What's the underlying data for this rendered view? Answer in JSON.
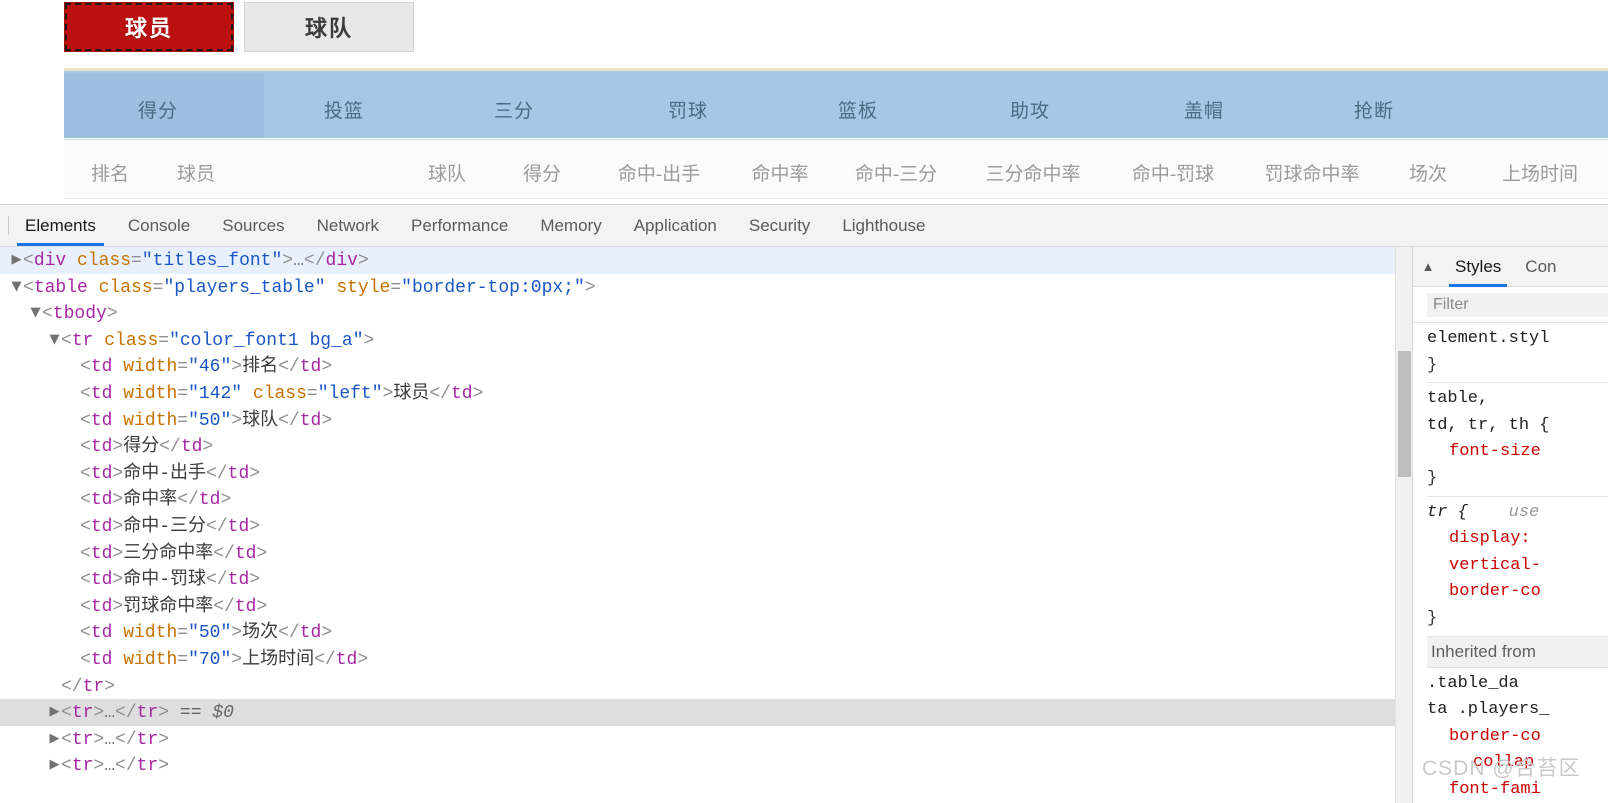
{
  "page": {
    "tabs": [
      {
        "label": "球员",
        "active": true
      },
      {
        "label": "球队",
        "active": false
      }
    ],
    "category_band": [
      {
        "label": "得分",
        "highlighted": true
      },
      {
        "label": "投篮",
        "highlighted": false
      },
      {
        "label": "三分",
        "highlighted": false
      },
      {
        "label": "罚球",
        "highlighted": false
      },
      {
        "label": "篮板",
        "highlighted": false
      },
      {
        "label": "助攻",
        "highlighted": false
      },
      {
        "label": "盖帽",
        "highlighted": false
      },
      {
        "label": "抢断",
        "highlighted": false
      }
    ],
    "column_headers": [
      "排名",
      "球员",
      "球队",
      "得分",
      "命中-出手",
      "命中率",
      "命中-三分",
      "三分命中率",
      "命中-罚球",
      "罚球命中率",
      "场次",
      "上场时间"
    ]
  },
  "devtools": {
    "tabs": [
      {
        "label": "Elements",
        "active": true
      },
      {
        "label": "Console",
        "active": false
      },
      {
        "label": "Sources",
        "active": false
      },
      {
        "label": "Network",
        "active": false
      },
      {
        "label": "Performance",
        "active": false
      },
      {
        "label": "Memory",
        "active": false
      },
      {
        "label": "Application",
        "active": false
      },
      {
        "label": "Security",
        "active": false
      },
      {
        "label": "Lighthouse",
        "active": false
      }
    ],
    "dom_tree": [
      {
        "indent": 0,
        "twisty": "right",
        "highlight": "blue",
        "parts": [
          {
            "t": "br",
            "v": "<"
          },
          {
            "t": "tag",
            "v": "div"
          },
          {
            "t": "sp",
            "v": " "
          },
          {
            "t": "attr",
            "v": "class"
          },
          {
            "t": "eq",
            "v": "="
          },
          {
            "t": "val",
            "v": "\"titles_font\""
          },
          {
            "t": "br",
            "v": ">"
          },
          {
            "t": "ell",
            "v": "…"
          },
          {
            "t": "br",
            "v": "</"
          },
          {
            "t": "tag",
            "v": "div"
          },
          {
            "t": "br",
            "v": ">"
          }
        ]
      },
      {
        "indent": 0,
        "twisty": "down",
        "highlight": "none",
        "parts": [
          {
            "t": "br",
            "v": "<"
          },
          {
            "t": "tag",
            "v": "table"
          },
          {
            "t": "sp",
            "v": " "
          },
          {
            "t": "attr",
            "v": "class"
          },
          {
            "t": "eq",
            "v": "="
          },
          {
            "t": "val",
            "v": "\"players_table\""
          },
          {
            "t": "sp",
            "v": " "
          },
          {
            "t": "attr",
            "v": "style"
          },
          {
            "t": "eq",
            "v": "="
          },
          {
            "t": "val",
            "v": "\"border-top:0px;\""
          },
          {
            "t": "br",
            "v": ">"
          }
        ]
      },
      {
        "indent": 1,
        "twisty": "down",
        "highlight": "none",
        "parts": [
          {
            "t": "br",
            "v": "<"
          },
          {
            "t": "tag",
            "v": "tbody"
          },
          {
            "t": "br",
            "v": ">"
          }
        ]
      },
      {
        "indent": 2,
        "twisty": "down",
        "highlight": "none",
        "parts": [
          {
            "t": "br",
            "v": "<"
          },
          {
            "t": "tag",
            "v": "tr"
          },
          {
            "t": "sp",
            "v": " "
          },
          {
            "t": "attr",
            "v": "class"
          },
          {
            "t": "eq",
            "v": "="
          },
          {
            "t": "val",
            "v": "\"color_font1 bg_a\""
          },
          {
            "t": "br",
            "v": ">"
          }
        ]
      },
      {
        "indent": 3,
        "twisty": "none",
        "highlight": "none",
        "parts": [
          {
            "t": "br",
            "v": "<"
          },
          {
            "t": "tag",
            "v": "td"
          },
          {
            "t": "sp",
            "v": " "
          },
          {
            "t": "attr",
            "v": "width"
          },
          {
            "t": "eq",
            "v": "="
          },
          {
            "t": "val",
            "v": "\"46\""
          },
          {
            "t": "br",
            "v": ">"
          },
          {
            "t": "txt",
            "v": "排名"
          },
          {
            "t": "br",
            "v": "</"
          },
          {
            "t": "tag",
            "v": "td"
          },
          {
            "t": "br",
            "v": ">"
          }
        ]
      },
      {
        "indent": 3,
        "twisty": "none",
        "highlight": "none",
        "parts": [
          {
            "t": "br",
            "v": "<"
          },
          {
            "t": "tag",
            "v": "td"
          },
          {
            "t": "sp",
            "v": " "
          },
          {
            "t": "attr",
            "v": "width"
          },
          {
            "t": "eq",
            "v": "="
          },
          {
            "t": "val",
            "v": "\"142\""
          },
          {
            "t": "sp",
            "v": " "
          },
          {
            "t": "attr",
            "v": "class"
          },
          {
            "t": "eq",
            "v": "="
          },
          {
            "t": "val",
            "v": "\"left\""
          },
          {
            "t": "br",
            "v": ">"
          },
          {
            "t": "txt",
            "v": "球员"
          },
          {
            "t": "br",
            "v": "</"
          },
          {
            "t": "tag",
            "v": "td"
          },
          {
            "t": "br",
            "v": ">"
          }
        ]
      },
      {
        "indent": 3,
        "twisty": "none",
        "highlight": "none",
        "parts": [
          {
            "t": "br",
            "v": "<"
          },
          {
            "t": "tag",
            "v": "td"
          },
          {
            "t": "sp",
            "v": " "
          },
          {
            "t": "attr",
            "v": "width"
          },
          {
            "t": "eq",
            "v": "="
          },
          {
            "t": "val",
            "v": "\"50\""
          },
          {
            "t": "br",
            "v": ">"
          },
          {
            "t": "txt",
            "v": "球队"
          },
          {
            "t": "br",
            "v": "</"
          },
          {
            "t": "tag",
            "v": "td"
          },
          {
            "t": "br",
            "v": ">"
          }
        ]
      },
      {
        "indent": 3,
        "twisty": "none",
        "highlight": "none",
        "parts": [
          {
            "t": "br",
            "v": "<"
          },
          {
            "t": "tag",
            "v": "td"
          },
          {
            "t": "br",
            "v": ">"
          },
          {
            "t": "txt",
            "v": "得分"
          },
          {
            "t": "br",
            "v": "</"
          },
          {
            "t": "tag",
            "v": "td"
          },
          {
            "t": "br",
            "v": ">"
          }
        ]
      },
      {
        "indent": 3,
        "twisty": "none",
        "highlight": "none",
        "parts": [
          {
            "t": "br",
            "v": "<"
          },
          {
            "t": "tag",
            "v": "td"
          },
          {
            "t": "br",
            "v": ">"
          },
          {
            "t": "txt",
            "v": "命中-出手"
          },
          {
            "t": "br",
            "v": "</"
          },
          {
            "t": "tag",
            "v": "td"
          },
          {
            "t": "br",
            "v": ">"
          }
        ]
      },
      {
        "indent": 3,
        "twisty": "none",
        "highlight": "none",
        "parts": [
          {
            "t": "br",
            "v": "<"
          },
          {
            "t": "tag",
            "v": "td"
          },
          {
            "t": "br",
            "v": ">"
          },
          {
            "t": "txt",
            "v": "命中率"
          },
          {
            "t": "br",
            "v": "</"
          },
          {
            "t": "tag",
            "v": "td"
          },
          {
            "t": "br",
            "v": ">"
          }
        ]
      },
      {
        "indent": 3,
        "twisty": "none",
        "highlight": "none",
        "parts": [
          {
            "t": "br",
            "v": "<"
          },
          {
            "t": "tag",
            "v": "td"
          },
          {
            "t": "br",
            "v": ">"
          },
          {
            "t": "txt",
            "v": "命中-三分"
          },
          {
            "t": "br",
            "v": "</"
          },
          {
            "t": "tag",
            "v": "td"
          },
          {
            "t": "br",
            "v": ">"
          }
        ]
      },
      {
        "indent": 3,
        "twisty": "none",
        "highlight": "none",
        "parts": [
          {
            "t": "br",
            "v": "<"
          },
          {
            "t": "tag",
            "v": "td"
          },
          {
            "t": "br",
            "v": ">"
          },
          {
            "t": "txt",
            "v": "三分命中率"
          },
          {
            "t": "br",
            "v": "</"
          },
          {
            "t": "tag",
            "v": "td"
          },
          {
            "t": "br",
            "v": ">"
          }
        ]
      },
      {
        "indent": 3,
        "twisty": "none",
        "highlight": "none",
        "parts": [
          {
            "t": "br",
            "v": "<"
          },
          {
            "t": "tag",
            "v": "td"
          },
          {
            "t": "br",
            "v": ">"
          },
          {
            "t": "txt",
            "v": "命中-罚球"
          },
          {
            "t": "br",
            "v": "</"
          },
          {
            "t": "tag",
            "v": "td"
          },
          {
            "t": "br",
            "v": ">"
          }
        ]
      },
      {
        "indent": 3,
        "twisty": "none",
        "highlight": "none",
        "parts": [
          {
            "t": "br",
            "v": "<"
          },
          {
            "t": "tag",
            "v": "td"
          },
          {
            "t": "br",
            "v": ">"
          },
          {
            "t": "txt",
            "v": "罚球命中率"
          },
          {
            "t": "br",
            "v": "</"
          },
          {
            "t": "tag",
            "v": "td"
          },
          {
            "t": "br",
            "v": ">"
          }
        ]
      },
      {
        "indent": 3,
        "twisty": "none",
        "highlight": "none",
        "parts": [
          {
            "t": "br",
            "v": "<"
          },
          {
            "t": "tag",
            "v": "td"
          },
          {
            "t": "sp",
            "v": " "
          },
          {
            "t": "attr",
            "v": "width"
          },
          {
            "t": "eq",
            "v": "="
          },
          {
            "t": "val",
            "v": "\"50\""
          },
          {
            "t": "br",
            "v": ">"
          },
          {
            "t": "txt",
            "v": "场次"
          },
          {
            "t": "br",
            "v": "</"
          },
          {
            "t": "tag",
            "v": "td"
          },
          {
            "t": "br",
            "v": ">"
          }
        ]
      },
      {
        "indent": 3,
        "twisty": "none",
        "highlight": "none",
        "parts": [
          {
            "t": "br",
            "v": "<"
          },
          {
            "t": "tag",
            "v": "td"
          },
          {
            "t": "sp",
            "v": " "
          },
          {
            "t": "attr",
            "v": "width"
          },
          {
            "t": "eq",
            "v": "="
          },
          {
            "t": "val",
            "v": "\"70\""
          },
          {
            "t": "br",
            "v": ">"
          },
          {
            "t": "txt",
            "v": "上场时间"
          },
          {
            "t": "br",
            "v": "</"
          },
          {
            "t": "tag",
            "v": "td"
          },
          {
            "t": "br",
            "v": ">"
          }
        ]
      },
      {
        "indent": 2,
        "twisty": "none",
        "highlight": "none",
        "parts": [
          {
            "t": "br",
            "v": "</"
          },
          {
            "t": "tag",
            "v": "tr"
          },
          {
            "t": "br",
            "v": ">"
          }
        ]
      },
      {
        "indent": 2,
        "twisty": "right",
        "highlight": "gray",
        "parts": [
          {
            "t": "br",
            "v": "<"
          },
          {
            "t": "tag",
            "v": "tr"
          },
          {
            "t": "br",
            "v": ">"
          },
          {
            "t": "ell",
            "v": "…"
          },
          {
            "t": "br",
            "v": "</"
          },
          {
            "t": "tag",
            "v": "tr"
          },
          {
            "t": "br",
            "v": ">"
          },
          {
            "t": "sp",
            "v": " "
          },
          {
            "t": "dollar",
            "v": "== $0"
          }
        ]
      },
      {
        "indent": 2,
        "twisty": "right",
        "highlight": "none",
        "parts": [
          {
            "t": "br",
            "v": "<"
          },
          {
            "t": "tag",
            "v": "tr"
          },
          {
            "t": "br",
            "v": ">"
          },
          {
            "t": "ell",
            "v": "…"
          },
          {
            "t": "br",
            "v": "</"
          },
          {
            "t": "tag",
            "v": "tr"
          },
          {
            "t": "br",
            "v": ">"
          }
        ]
      },
      {
        "indent": 2,
        "twisty": "right",
        "highlight": "none",
        "parts": [
          {
            "t": "br",
            "v": "<"
          },
          {
            "t": "tag",
            "v": "tr"
          },
          {
            "t": "br",
            "v": ">"
          },
          {
            "t": "ell",
            "v": "…"
          },
          {
            "t": "br",
            "v": "</"
          },
          {
            "t": "tag",
            "v": "tr"
          },
          {
            "t": "br",
            "v": ">"
          }
        ]
      }
    ],
    "styles_panel": {
      "collapse_icon": "▲",
      "tabs": [
        {
          "label": "Styles",
          "active": true
        },
        {
          "label": "Con",
          "active": false
        }
      ],
      "filter_placeholder": "Filter",
      "kebab_icon": "⋮",
      "rules": [
        {
          "selector": "element.styl",
          "ua": "",
          "declarations": [],
          "close": "}"
        },
        {
          "selector": "table,\ntd, tr, th {",
          "ua": "",
          "declarations": [
            "font-size"
          ],
          "close": "}"
        },
        {
          "selector": "tr {",
          "ua": "use",
          "declarations": [
            "display:",
            "vertical-",
            "border-co"
          ],
          "close": "}"
        }
      ],
      "inherited_label": "Inherited from",
      "inherited_rule": {
        "selector": ".table_da\nta .players_",
        "declarations": [
          "border-co",
          "collap",
          "font-fami"
        ]
      }
    }
  },
  "watermark": {
    "text": "CSDN @合苔区"
  }
}
